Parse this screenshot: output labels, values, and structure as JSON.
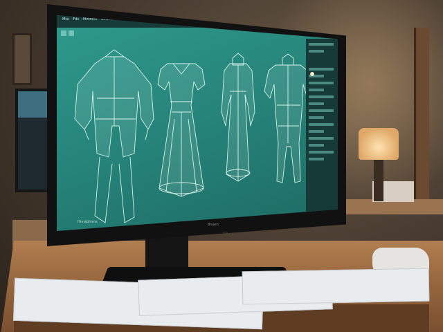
{
  "scene": {
    "colors": {
      "screen": "#2f9a8d",
      "panel": "#163a37",
      "wireframe": "#d9f3ee",
      "desk": "#b07e50"
    }
  },
  "software": {
    "menu": [
      "Mta",
      "Fds",
      "Mntnms",
      "Stntmn",
      "Shnhi",
      "Slbtnce",
      "Sntn"
    ],
    "panel_label": "Pctrs",
    "status_text": "Hnnsbhtrns",
    "brand": "Bnaeh",
    "logo_glyph": "⌒"
  },
  "design_icons": [
    "jacket-icon",
    "dress-icon",
    "gown-icon",
    "bodysuit-icon"
  ]
}
